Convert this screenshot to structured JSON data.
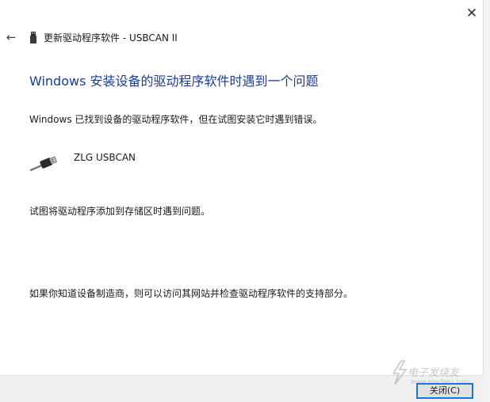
{
  "window": {
    "close_glyph": "✕"
  },
  "titlebar": {
    "back_glyph": "←",
    "title": "更新驱动程序软件 - USBCAN II"
  },
  "content": {
    "heading": "Windows 安装设备的驱动程序软件时遇到一个问题",
    "found_message": "Windows 已找到设备的驱动程序软件，但在试图安装它时遇到错误。",
    "device_name": "ZLG USBCAN",
    "error_detail": "试图将驱动程序添加到存储区时遇到问题。",
    "help_message": "如果你知道设备制造商，则可以访问其网站并检查驱动程序软件的支持部分。"
  },
  "footer": {
    "close_button_label": "关闭(C)"
  },
  "watermark": {
    "text": "电子发烧友",
    "url": "www.elecfans.com"
  },
  "icons": {
    "back": "back-arrow-icon",
    "usb_small": "usb-device-icon",
    "usb_large": "usb-cable-icon",
    "close": "close-icon",
    "watermark": "elecfans-logo"
  },
  "colors": {
    "heading": "#1a3c9a",
    "button_focus_border": "#1877d6",
    "footer_bg": "#f0f0f0"
  }
}
